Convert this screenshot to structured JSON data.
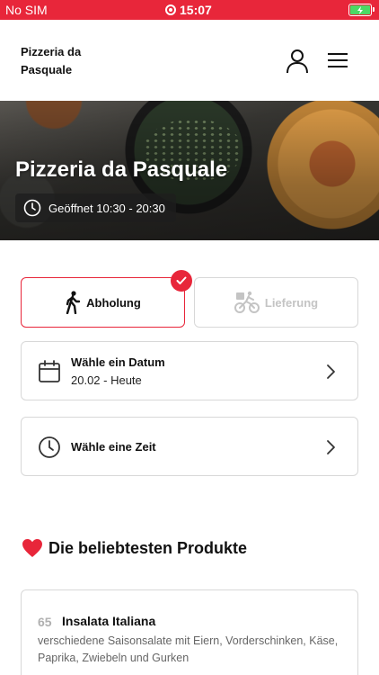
{
  "status_bar": {
    "carrier": "No SIM",
    "time": "15:07",
    "battery_color": "#4cd964"
  },
  "header": {
    "brand": "Pizzeria da Pasquale"
  },
  "hero": {
    "title": "Pizzeria da Pasquale",
    "hours": "Geöffnet 10:30 - 20:30"
  },
  "order_mode": {
    "pickup_label": "Abholung",
    "delivery_label": "Lieferung",
    "selected": "pickup"
  },
  "date_select": {
    "title": "Wähle ein Datum",
    "value": "20.02 - Heute"
  },
  "time_select": {
    "title": "Wähle eine Zeit"
  },
  "popular": {
    "title": "Die beliebtesten Produkte",
    "icon": "heart-icon",
    "items": [
      {
        "number": "65",
        "name": "Insalata Italiana",
        "description": "verschiedene Saisonsalate mit Eiern, Vorderschinken, Käse, Paprika, Zwiebeln und Gurken"
      }
    ]
  },
  "colors": {
    "accent": "#e8263a",
    "border": "#d8d8d8",
    "muted": "#c4c4c4"
  }
}
